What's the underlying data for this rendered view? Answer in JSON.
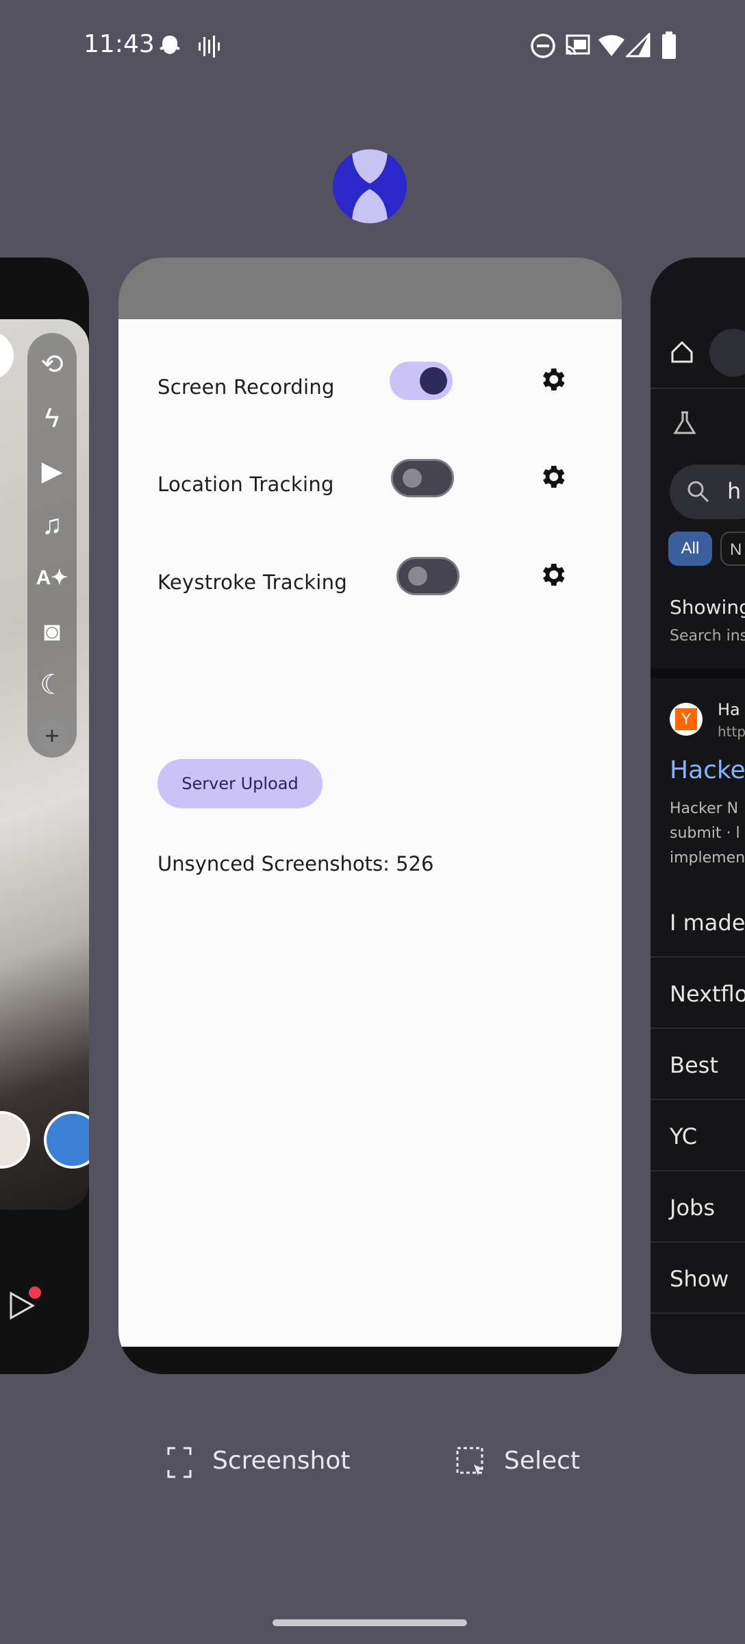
{
  "status_bar": {
    "time": "11:43"
  },
  "center_card": {
    "rows": [
      {
        "label": "Screen Recording",
        "enabled": true
      },
      {
        "label": "Location Tracking",
        "enabled": false
      },
      {
        "label": "Keystroke Tracking",
        "enabled": false
      }
    ],
    "upload_button": "Server Upload",
    "unsynced": "Unsynced Screenshots: 526"
  },
  "right_card": {
    "search_text": "h",
    "chip_all": "All",
    "chip_next": "N",
    "showing": "Showing",
    "search_ins": "Search ins",
    "site_name": "Ha",
    "site_url": "http",
    "result_title": "Hacke",
    "snippet_1": "Hacker N",
    "snippet_2": "submit · l",
    "snippet_3": "implemen",
    "links": [
      "I made",
      "Nextflo",
      "Best",
      "YC",
      "Jobs",
      "Show"
    ]
  },
  "actions": {
    "screenshot": "Screenshot",
    "select": "Select"
  },
  "colors": {
    "background": "#54525f",
    "accent": "#cbc2f7",
    "app_icon": "#2b27c9"
  }
}
